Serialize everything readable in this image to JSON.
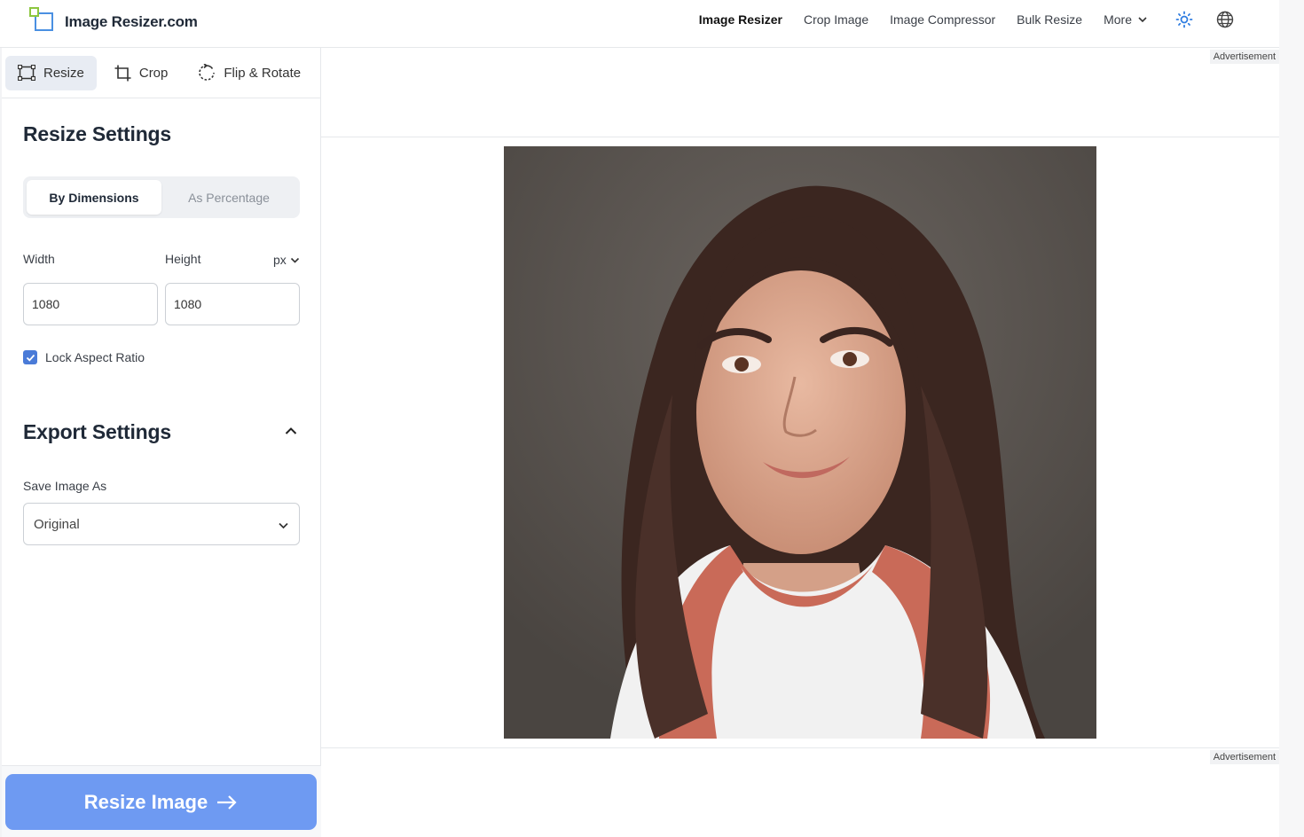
{
  "header": {
    "logo_text": "Image Resizer.com",
    "nav": [
      "Image Resizer",
      "Crop Image",
      "Image Compressor",
      "Bulk Resize"
    ],
    "more_label": "More"
  },
  "tools": {
    "resize": "Resize",
    "crop": "Crop",
    "flip": "Flip & Rotate"
  },
  "resize_settings": {
    "title": "Resize Settings",
    "mode_dimensions": "By Dimensions",
    "mode_percentage": "As Percentage",
    "width_label": "Width",
    "height_label": "Height",
    "unit": "px",
    "width_value": "1080",
    "height_value": "1080",
    "lock_label": "Lock Aspect Ratio",
    "lock_checked": true
  },
  "export_settings": {
    "title": "Export Settings",
    "save_as_label": "Save Image As",
    "save_as_value": "Original"
  },
  "action": {
    "label": "Resize Image"
  },
  "ads": {
    "label": "Advertisement"
  },
  "colors": {
    "accent": "#6e9af2",
    "checkbox": "#4a7bd8"
  }
}
